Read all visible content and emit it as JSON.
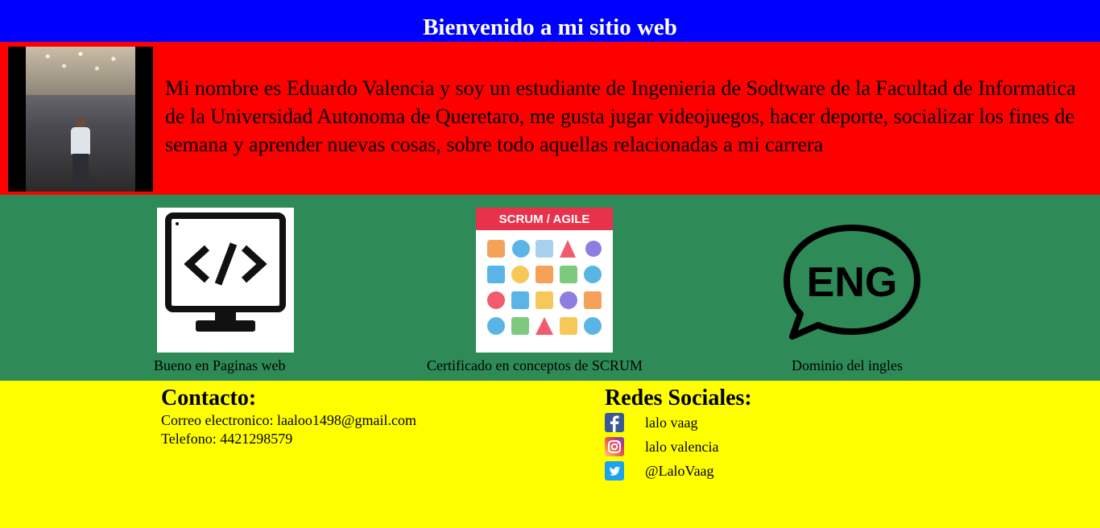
{
  "header": {
    "title": "Bienvenido a mi sitio web"
  },
  "about": {
    "text": "Mi nombre es Eduardo Valencia y soy un estudiante de Ingenieria de Sodtware de la Facultad de Informatica de la Universidad Autonoma de Queretaro, me gusta jugar videojuegos, hacer deporte, socializar los fines de semana y aprender nuevas cosas, sobre todo aquellas relacionadas a mi carrera"
  },
  "skills": [
    {
      "caption": "Bueno en Paginas web",
      "icon": "monitor-code-icon"
    },
    {
      "caption": "Certificado en conceptos de SCRUM",
      "icon": "scrum-agile-icon",
      "badge": "SCRUM / AGILE"
    },
    {
      "caption": "Dominio del ingles",
      "icon": "eng-speech-bubble-icon",
      "badge": "ENG"
    }
  ],
  "contact": {
    "title": "Contacto:",
    "email_line": "Correo electronico: laaloo1498@gmail.com",
    "phone_line": "Telefono: 4421298579"
  },
  "social": {
    "title": "Redes Sociales:",
    "items": [
      {
        "label": "lalo vaag",
        "icon": "facebook-icon"
      },
      {
        "label": "lalo valencia",
        "icon": "instagram-icon"
      },
      {
        "label": "@LaloVaag",
        "icon": "twitter-icon"
      }
    ]
  },
  "colors": {
    "header_bg": "#0000ff",
    "about_bg": "#ff0000",
    "skills_bg": "#2e8b57",
    "contact_bg": "#ffff00"
  }
}
